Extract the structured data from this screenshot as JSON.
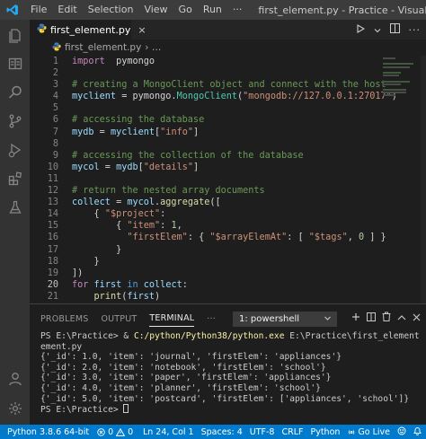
{
  "window": {
    "title": "first_element.py - Practice - Visual ...",
    "menu": [
      "File",
      "Edit",
      "Selection",
      "View",
      "Go",
      "Run",
      "···"
    ]
  },
  "tab": {
    "label": "first_element.py",
    "close": "×"
  },
  "breadcrumb": {
    "file": "first_element.py",
    "symbol": "› …"
  },
  "editor": {
    "line_numbers": [
      "1",
      "2",
      "3",
      "4",
      "5",
      "6",
      "7",
      "8",
      "9",
      "10",
      "11",
      "12",
      "13",
      "14",
      "15",
      "16",
      "17",
      "18",
      "19",
      "20",
      "21"
    ],
    "active_line": "20"
  },
  "panel": {
    "tabs": [
      "PROBLEMS",
      "OUTPUT",
      "TERMINAL",
      "···"
    ],
    "active_tab": "TERMINAL",
    "shell": "1: powershell",
    "terminal": {
      "cmd_prompt": "PS E:\\Practice> & ",
      "cmd_exe": "C:/python/Python38/python.exe",
      "cmd_arg": " E:\\Practice\\first_element",
      "cmd_wrap": "ement.py",
      "outputs": [
        "{'_id': 1.0, 'item': 'journal', 'firstElem': 'appliances'}",
        "{'_id': 2.0, 'item': 'notebook', 'firstElem': 'school'}",
        "{'_id': 3.0, 'item': 'paper', 'firstElem': 'appliances'}",
        "{'_id': 4.0, 'item': 'planner', 'firstElem': 'school'}",
        "{'_id': 5.0, 'item': 'postcard', 'firstElem': ['appliances', 'school']}"
      ],
      "prompt_end": "PS E:\\Practice> "
    }
  },
  "status": {
    "interpreter": "Python 3.8.6 64-bit",
    "errors": "0",
    "warnings": "0",
    "position": "Ln 24, Col 1",
    "spaces": "Spaces: 4",
    "encoding": "UTF-8",
    "eol": "CRLF",
    "language": "Python",
    "golive": "Go Live"
  },
  "colors": {
    "titlebar": "#3c3c3c",
    "activitybar": "#333333",
    "editor_bg": "#1e1e1e",
    "statusbar": "#007acc"
  }
}
